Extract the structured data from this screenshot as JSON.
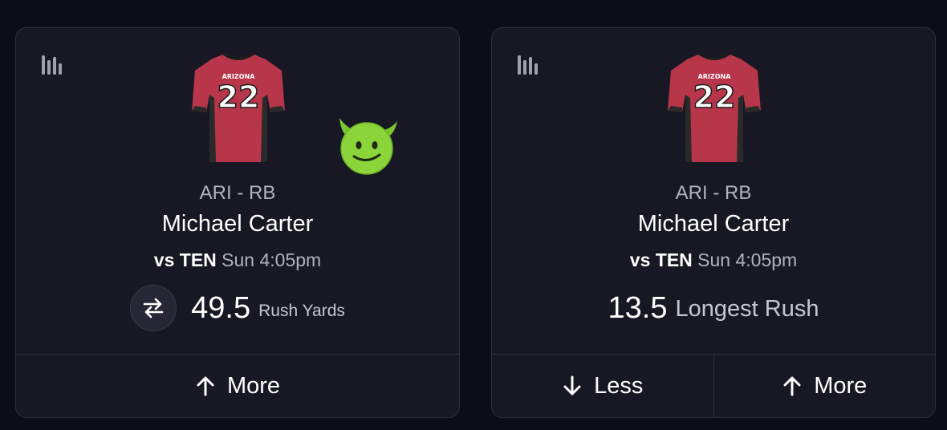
{
  "colors": {
    "background": "#0c0d16",
    "card": "#171824",
    "jersey_red": "#b8364a",
    "devil_green": "#8bd43a"
  },
  "cards": [
    {
      "stats_icon": "bar-chart-icon",
      "jersey": {
        "team_text": "ARIZONA",
        "number": "22"
      },
      "badge_icon": "smiling-devil-emoji-icon",
      "team_position": "ARI - RB",
      "player_name": "Michael Carter",
      "matchup_prefix": "vs",
      "opponent": "TEN",
      "game_time": "Sun 4:05pm",
      "swap_icon": "swap-arrows-icon",
      "line_value": "49.5",
      "line_stat": "Rush Yards",
      "buttons": [
        {
          "label": "More",
          "icon": "arrow-up-icon"
        }
      ]
    },
    {
      "stats_icon": "bar-chart-icon",
      "jersey": {
        "team_text": "ARIZONA",
        "number": "22"
      },
      "team_position": "ARI - RB",
      "player_name": "Michael Carter",
      "matchup_prefix": "vs",
      "opponent": "TEN",
      "game_time": "Sun 4:05pm",
      "line_value": "13.5",
      "line_stat": "Longest Rush",
      "buttons": [
        {
          "label": "Less",
          "icon": "arrow-down-icon"
        },
        {
          "label": "More",
          "icon": "arrow-up-icon"
        }
      ]
    }
  ]
}
